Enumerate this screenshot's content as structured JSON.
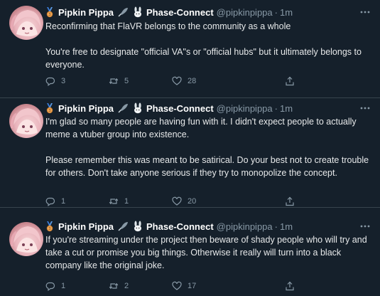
{
  "tweets": [
    {
      "author_name": "Pipkin Pippa",
      "group_name": "Phase-Connect",
      "handle": "@pipkinpippa",
      "separator": "·",
      "time": "1m",
      "text": "Reconfirming that FlaVR belongs to the community as a whole\n\nYou're free to designate \"official VA\"s or \"official hubs\" but it ultimately belongs to everyone.",
      "replies": "3",
      "retweets": "5",
      "likes": "28"
    },
    {
      "author_name": "Pipkin Pippa",
      "group_name": "Phase-Connect",
      "handle": "@pipkinpippa",
      "separator": "·",
      "time": "1m",
      "text": "I'm glad so many people are having fun with it. I didn't expect people to actually meme a vtuber group into existence.\n\nPlease remember this was meant to be satirical. Do your best not to create trouble for others. Don't take anyone serious if they try to monopolize the concept.",
      "replies": "1",
      "retweets": "1",
      "likes": "20"
    },
    {
      "author_name": "Pipkin Pippa",
      "group_name": "Phase-Connect",
      "handle": "@pipkinpippa",
      "separator": "·",
      "time": "1m",
      "text": "If you're streaming under the project then beware of shady people who will try and take a cut or promise you big things. Otherwise it really will turn into a black company like the original joke.",
      "replies": "1",
      "retweets": "2",
      "likes": "17"
    }
  ],
  "colors": {
    "background": "#15202b",
    "muted": "#8899a6",
    "text": "#e7e9ea",
    "divider": "#38444d"
  },
  "icons": [
    "medal-icon",
    "feather-badge-icon",
    "bunny-icon",
    "more-icon",
    "reply-icon",
    "retweet-icon",
    "like-icon",
    "share-icon"
  ]
}
